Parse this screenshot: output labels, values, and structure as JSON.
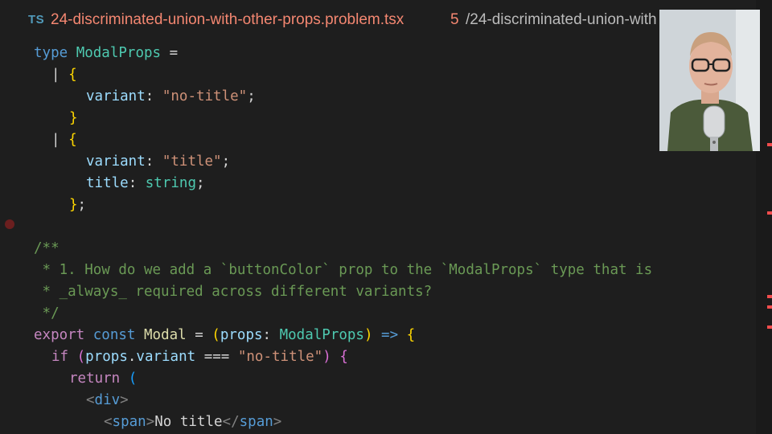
{
  "tab": {
    "language_badge": "TS",
    "filename": "24-discriminated-union-with-other-props.problem.tsx",
    "problem_count": "5",
    "path": "/24-discriminated-union-with"
  },
  "code": {
    "l1": {
      "kw": "type",
      "name": "ModalProps",
      "eq": " ="
    },
    "l2": {
      "pipe": "| ",
      "brace": "{"
    },
    "l3": {
      "prop": "variant",
      "colon": ": ",
      "val": "\"no-title\"",
      "semi": ";"
    },
    "l4": {
      "brace": "}"
    },
    "l5": {
      "pipe": "| ",
      "brace": "{"
    },
    "l6": {
      "prop": "variant",
      "colon": ": ",
      "val": "\"title\"",
      "semi": ";"
    },
    "l7": {
      "prop": "title",
      "colon": ": ",
      "type": "string",
      "semi": ";"
    },
    "l8": {
      "brace": "}",
      "semi": ";"
    },
    "l10": "/**",
    "l11": " * 1. How do we add a `buttonColor` prop to the `ModalProps` type that is",
    "l12": " * _always_ required across different variants?",
    "l13": " */",
    "l14": {
      "export": "export",
      "const": "const",
      "name": "Modal",
      "eq": " = ",
      "paren": "(",
      "param": "props",
      "colon": ": ",
      "type": "ModalProps",
      "close": ")",
      "arrow": " => ",
      "brace": "{"
    },
    "l15": {
      "if": "if",
      "paren": "(",
      "obj": "props",
      "dot": ".",
      "prop": "variant",
      "op": " === ",
      "val": "\"no-title\"",
      "close": ")",
      "brace": "{"
    },
    "l16": {
      "ret": "return",
      "paren": "("
    },
    "l17": {
      "open": "<",
      "tag": "div",
      "close": ">"
    },
    "l18": {
      "open": "<",
      "tag": "span",
      "close": ">",
      "text": "No title",
      "eopen": "</",
      "etag": "span",
      "eclose": ">"
    }
  },
  "colors": {
    "background": "#1e1e1e",
    "error": "#f48771",
    "keyword": "#569cd6",
    "type": "#4ec9b0",
    "string": "#ce9178",
    "comment": "#6a9955"
  }
}
